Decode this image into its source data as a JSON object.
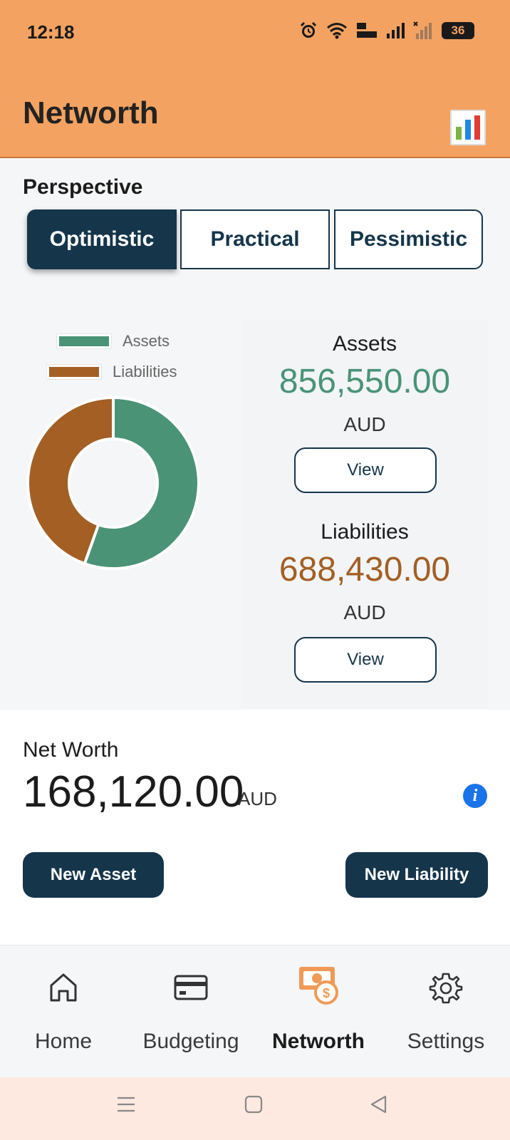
{
  "status_bar": {
    "time": "12:18",
    "battery": "36",
    "icons": [
      "alarm-icon",
      "wifi-icon",
      "volte-icon",
      "signal-icon",
      "signal-no-service-icon",
      "battery-icon"
    ]
  },
  "app_bar": {
    "title": "Networth",
    "action_icon": "bar-chart-icon"
  },
  "perspective": {
    "label": "Perspective",
    "options": [
      "Optimistic",
      "Practical",
      "Pessimistic"
    ],
    "selected": "Optimistic"
  },
  "chart_data": {
    "type": "pie",
    "legend": [
      "Assets",
      "Liabilities"
    ],
    "values": [
      856550.0,
      688430.0
    ],
    "colors": [
      "#4a9377",
      "#a35f24"
    ],
    "donut": true
  },
  "summary": {
    "assets": {
      "label": "Assets",
      "value": "856,550.00",
      "unit": "AUD",
      "button": "View",
      "color": "#4a9377"
    },
    "liabilities": {
      "label": "Liabilities",
      "value": "688,430.00",
      "unit": "AUD",
      "button": "View",
      "color": "#a35f24"
    }
  },
  "net_worth": {
    "label": "Net Worth",
    "value": "168,120.00",
    "unit": "AUD",
    "info_icon": "i"
  },
  "actions": {
    "new_asset": "New Asset",
    "new_liability": "New Liability"
  },
  "bottom_nav": {
    "items": [
      {
        "label": "Home",
        "icon": "home-icon"
      },
      {
        "label": "Budgeting",
        "icon": "credit-card-icon"
      },
      {
        "label": "Networth",
        "icon": "money-icon"
      },
      {
        "label": "Settings",
        "icon": "gear-icon"
      }
    ],
    "active": "Networth"
  },
  "system_nav": {
    "icons": [
      "menu-icon",
      "home-square-icon",
      "back-icon"
    ]
  },
  "colors": {
    "app_bar": "#f4a261",
    "primary": "#15354b",
    "assets": "#4a9377",
    "liabilities": "#a35f24",
    "active_nav_icon": "#f09a56"
  }
}
